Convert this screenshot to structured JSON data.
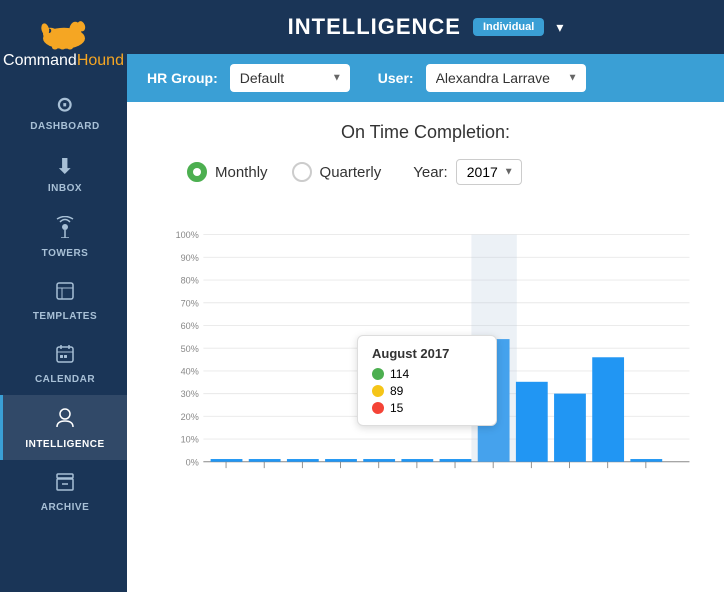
{
  "app": {
    "name_command": "Command",
    "name_hound": "Hound"
  },
  "topbar": {
    "title": "INTELLIGENCE",
    "badge": "Individual",
    "dropdown_arrow": "▾"
  },
  "filter_bar": {
    "hr_group_label": "HR Group:",
    "hr_group_value": "Default",
    "user_label": "User:",
    "user_value": "Alexandra Larrave"
  },
  "chart": {
    "title": "On Time Completion:",
    "view_monthly": "Monthly",
    "view_quarterly": "Quarterly",
    "year_label": "Year:",
    "year_value": "2017"
  },
  "tooltip": {
    "title": "August 2017",
    "green_value": "114",
    "yellow_value": "89",
    "red_value": "15"
  },
  "nav": {
    "items": [
      {
        "label": "DASHBOARD",
        "icon": "⊙"
      },
      {
        "label": "INBOX",
        "icon": "⬇"
      },
      {
        "label": "TOWERS",
        "icon": "📡"
      },
      {
        "label": "TEMPLATES",
        "icon": "▦"
      },
      {
        "label": "CALENDAR",
        "icon": "▦"
      },
      {
        "label": "INTELLIGENCE",
        "icon": "👤"
      },
      {
        "label": "ARCHIVE",
        "icon": "▤"
      }
    ]
  },
  "chart_data": {
    "bars": [
      1,
      1,
      1,
      1,
      1,
      1,
      1,
      54,
      35,
      30,
      46,
      1
    ],
    "highlight_index": 7,
    "y_labels": [
      "100%",
      "90%",
      "80%",
      "70%",
      "60%",
      "50%",
      "40%",
      "30%",
      "20%",
      "10%",
      "0%"
    ]
  }
}
